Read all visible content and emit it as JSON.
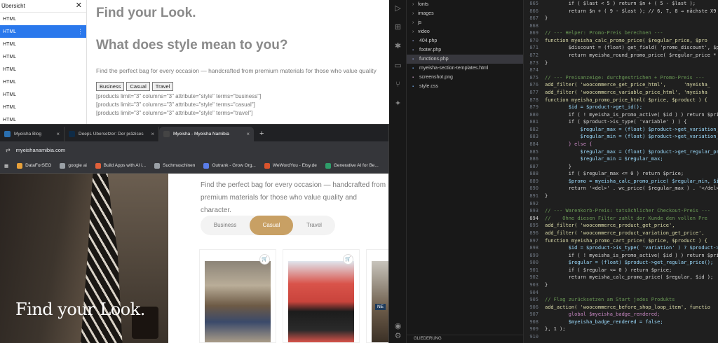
{
  "editor": {
    "outline_title": "Übersicht",
    "outline_items": [
      "HTML",
      "HTML",
      "HTML",
      "HTML",
      "HTML",
      "HTML",
      "HTML",
      "HTML",
      "HTML"
    ],
    "heading1": "Find your Look.",
    "heading2": "What does style mean to you?",
    "paragraph": "Find the perfect bag for every occasion — handcrafted from premium materials for those who value quality",
    "buttons": [
      "Business",
      "Casual",
      "Travel"
    ],
    "shortcodes": [
      "[products limit=\"3\" columns=\"3\" attribute=\"style\" terms=\"business\"]",
      "[products limit=\"3\" columns=\"3\" attribute=\"style\" terms=\"casual\"]",
      "[products limit=\"3\" columns=\"3\" attribute=\"style\" terms=\"travel\"]"
    ]
  },
  "vscode": {
    "explorer": [
      {
        "label": "fonts",
        "type": "folder"
      },
      {
        "label": "images",
        "type": "folder"
      },
      {
        "label": "js",
        "type": "folder"
      },
      {
        "label": "video",
        "type": "folder"
      },
      {
        "label": "404.php",
        "type": "php"
      },
      {
        "label": "footer.php",
        "type": "php"
      },
      {
        "label": "functions.php",
        "type": "php",
        "selected": true
      },
      {
        "label": "myeisha-section-templates.html",
        "type": "html"
      },
      {
        "label": "screenshot.png",
        "type": "png"
      },
      {
        "label": "style.css",
        "type": "css"
      }
    ],
    "outline_label": "GLIEDERUNG",
    "current_line": "894",
    "code": [
      {
        "n": "865",
        "t": "        if ( $last < 5 ) return $n + ( 5 - $last );",
        "k": "ct"
      },
      {
        "n": "866",
        "t": "        return $n + ( 9 - $last ); // 6, 7, 8 → nächste X9",
        "k": "ct"
      },
      {
        "n": "867",
        "t": "}",
        "k": "ct"
      },
      {
        "n": "868",
        "t": "",
        "k": "ct"
      },
      {
        "n": "869",
        "t": "// --- Helper: Promo-Preis berechnen ---",
        "k": "cm"
      },
      {
        "n": "870",
        "t": "function myeisha_calc_promo_price( $regular_price, $pro",
        "k": "fn"
      },
      {
        "n": "871",
        "t": "        $discount = (float) get_field( 'promo_discount', $p",
        "k": "ct"
      },
      {
        "n": "872",
        "t": "        return myeisha_round_promo_price( $regular_price *",
        "k": "ct"
      },
      {
        "n": "873",
        "t": "}",
        "k": "ct"
      },
      {
        "n": "874",
        "t": "",
        "k": "ct"
      },
      {
        "n": "875",
        "t": "// --- Preisanzeige: durchgestrichen + Promo-Preis ---",
        "k": "cm"
      },
      {
        "n": "876",
        "t": "add_filter( 'woocommerce_get_price_html',      'myeisha_",
        "k": "fn"
      },
      {
        "n": "877",
        "t": "add_filter( 'woocommerce_variable_price_html', 'myeisha",
        "k": "fn"
      },
      {
        "n": "878",
        "t": "function myeisha_promo_price_html( $price, $product ) {",
        "k": "fn"
      },
      {
        "n": "879",
        "t": "        $id = $product->get_id();",
        "k": "vr"
      },
      {
        "n": "880",
        "t": "        if ( ! myeisha_is_promo_active( $id ) ) return $pri",
        "k": "ct"
      },
      {
        "n": "881",
        "t": "        if ( $product->is_type( 'variable' ) ) {",
        "k": "ct"
      },
      {
        "n": "882",
        "t": "            $regular_max = (float) $product->get_variation_",
        "k": "vr"
      },
      {
        "n": "883",
        "t": "            $regular_min = (float) $product->get_variation_",
        "k": "vr"
      },
      {
        "n": "884",
        "t": "        } else {",
        "k": "kw"
      },
      {
        "n": "885",
        "t": "            $regular_max = (float) $product->get_regular_pr",
        "k": "vr"
      },
      {
        "n": "886",
        "t": "            $regular_min = $regular_max;",
        "k": "vr"
      },
      {
        "n": "887",
        "t": "        }",
        "k": "ct"
      },
      {
        "n": "888",
        "t": "        if ( $regular_max <= 0 ) return $price;",
        "k": "ct"
      },
      {
        "n": "889",
        "t": "        $promo = myeisha_calc_promo_price( $regular_min, $i",
        "k": "vr"
      },
      {
        "n": "890",
        "t": "        return '<del>' . wc_price( $regular_max ) . '</del>",
        "k": "ct"
      },
      {
        "n": "891",
        "t": "}",
        "k": "ct"
      },
      {
        "n": "892",
        "t": "",
        "k": "ct"
      },
      {
        "n": "893",
        "t": "// --- Warenkorb-Preis: tatsächlicher Checkout-Preis ---",
        "k": "cm"
      },
      {
        "n": "894",
        "t": "//    Ohne diesen Filter zahlt der Kunde den vollen Pre",
        "k": "cm"
      },
      {
        "n": "895",
        "t": "add_filter( 'woocommerce_product_get_price',",
        "k": "fn"
      },
      {
        "n": "896",
        "t": "add_filter( 'woocommerce_product_variation_get_price',",
        "k": "fn"
      },
      {
        "n": "897",
        "t": "function myeisha_promo_cart_price( $price, $product ) {",
        "k": "fn"
      },
      {
        "n": "898",
        "t": "        $id = $product->is_type( 'variation' ) ? $product->",
        "k": "vr"
      },
      {
        "n": "899",
        "t": "        if ( ! myeisha_is_promo_active( $id ) ) return $pri",
        "k": "ct"
      },
      {
        "n": "900",
        "t": "        $regular = (float) $product->get_regular_price();",
        "k": "vr"
      },
      {
        "n": "901",
        "t": "        if ( $regular <= 0 ) return $price;",
        "k": "ct"
      },
      {
        "n": "902",
        "t": "        return myeisha_calc_promo_price( $regular, $id );",
        "k": "ct"
      },
      {
        "n": "903",
        "t": "}",
        "k": "ct"
      },
      {
        "n": "904",
        "t": "",
        "k": "ct"
      },
      {
        "n": "905",
        "t": "// Flag zurücksetzen am Start jedes Produkts",
        "k": "cm"
      },
      {
        "n": "906",
        "t": "add_action( 'woocommerce_before_shop_loop_item', functio",
        "k": "fn"
      },
      {
        "n": "907",
        "t": "        global $myeisha_badge_rendered;",
        "k": "kw"
      },
      {
        "n": "908",
        "t": "        $myeisha_badge_rendered = false;",
        "k": "vr"
      },
      {
        "n": "909",
        "t": "}, 1 );",
        "k": "ct"
      },
      {
        "n": "910",
        "t": "",
        "k": "ct"
      }
    ]
  },
  "browser": {
    "tabs": [
      {
        "label": "Myeisha Blog",
        "icon_color": "#2a6fb0"
      },
      {
        "label": "DeepL Übersetzer: Der präzises",
        "icon_color": "#0f2b46"
      },
      {
        "label": "Myeisha - Myeisha Namibia",
        "icon_color": "#444",
        "active": true
      }
    ],
    "url": "myeishanamibia.com",
    "bookmarks": [
      {
        "label": "DataForSEO",
        "color": "#e8a13a"
      },
      {
        "label": "google ai",
        "color": "#9aa0a6"
      },
      {
        "label": "Build Apps with AI i...",
        "color": "#e0603a"
      },
      {
        "label": "Suchmaschinen",
        "color": "#9aa0a6"
      },
      {
        "label": "Outrank - Grow Org...",
        "color": "#5a7de8"
      },
      {
        "label": "WeWordYou - Etsy.de",
        "color": "#d9532c"
      },
      {
        "label": "Generative AI for Be...",
        "color": "#2e9e6a"
      }
    ],
    "hero_title": "Find your Look.",
    "paragraph": "Find the perfect bag for every occasion — handcrafted from premium materials for those who value quality and character.",
    "style_pills": [
      "Business",
      "Casual",
      "Travel"
    ],
    "active_pill": "Casual",
    "accent": "#c8a064",
    "badge": "NE"
  }
}
